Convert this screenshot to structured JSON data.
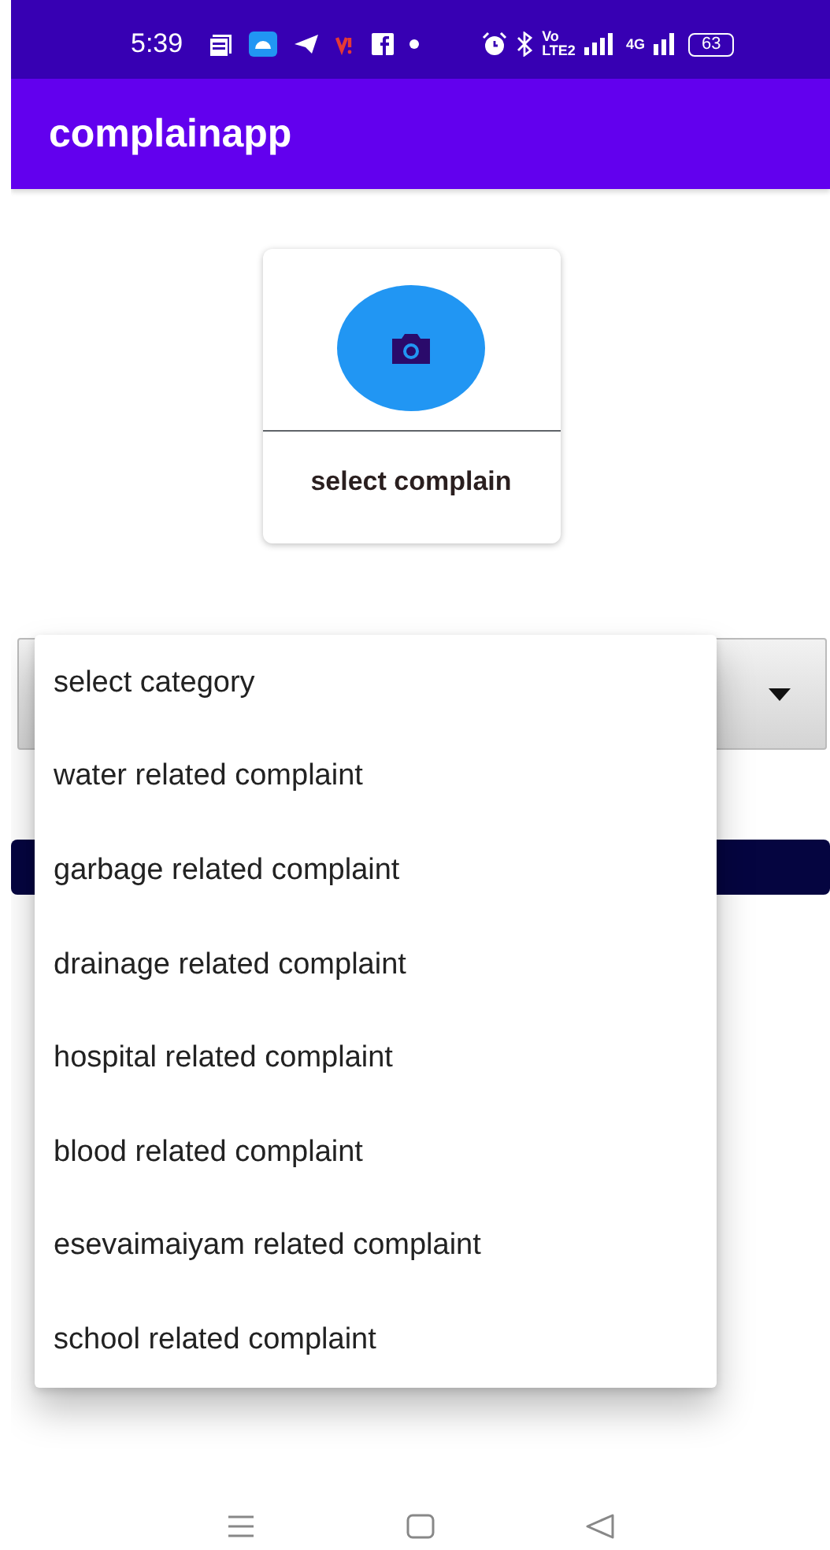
{
  "status_bar": {
    "time": "5:39",
    "network_texts": [
      "Vo",
      "LTE2",
      "4G"
    ],
    "battery": "63"
  },
  "app_bar": {
    "title": "complainapp"
  },
  "complaint_card": {
    "label": "select complain"
  },
  "category_menu": {
    "items": [
      {
        "label": "select category"
      },
      {
        "label": "water related complaint"
      },
      {
        "label": "garbage related complaint"
      },
      {
        "label": "drainage related complaint"
      },
      {
        "label": "hospital related complaint"
      },
      {
        "label": "blood related complaint"
      },
      {
        "label": "esevaimaiyam related complaint"
      },
      {
        "label": "school related complaint"
      }
    ]
  }
}
